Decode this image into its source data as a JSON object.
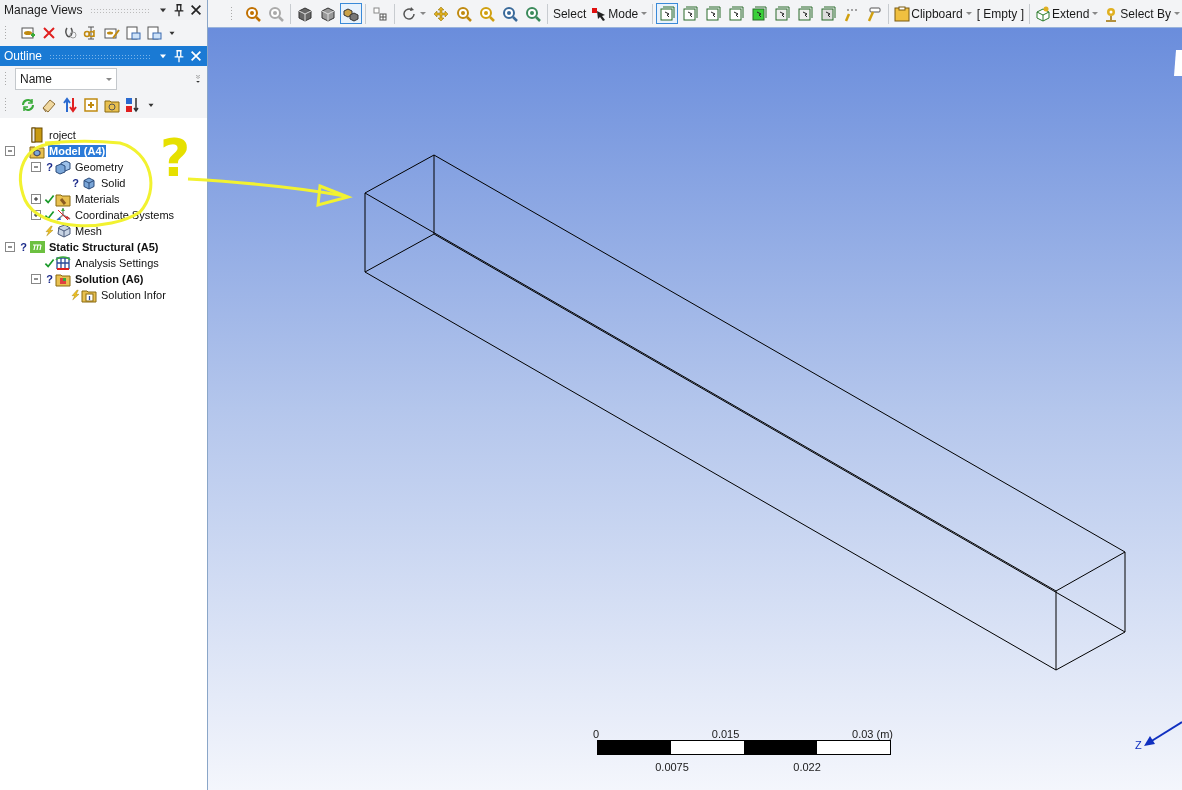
{
  "manage_views": {
    "title": "Manage Views"
  },
  "outline": {
    "title": "Outline",
    "sort_field": "Name"
  },
  "tree": [
    {
      "label": "roject",
      "bold": false,
      "selected": false,
      "children": [
        {
          "label": "Model (A4)",
          "bold": true,
          "selected": true,
          "expanded": true,
          "children": [
            {
              "label": "Geometry",
              "bold": false,
              "selected": false,
              "expanded": true,
              "kind": "question",
              "mark": "?",
              "children": [
                {
                  "label": "Solid",
                  "bold": false,
                  "selected": false,
                  "kind": "question",
                  "mark": "?"
                }
              ]
            },
            {
              "label": "Materials",
              "bold": false,
              "selected": false,
              "expanded": false,
              "kind": "ok"
            },
            {
              "label": "Coordinate Systems",
              "bold": false,
              "selected": false,
              "expanded": false,
              "kind": "ok"
            },
            {
              "label": "Mesh",
              "bold": false,
              "selected": false,
              "kind": "pending"
            }
          ]
        },
        {
          "label": "Static Structural (A5)",
          "bold": true,
          "selected": false,
          "expanded": true,
          "kind": "question",
          "mark": "?",
          "children": [
            {
              "label": "Analysis Settings",
              "bold": false,
              "selected": false,
              "kind": "ok"
            },
            {
              "label": "Solution (A6)",
              "bold": true,
              "selected": false,
              "expanded": true,
              "kind": "question",
              "mark": "?",
              "children": [
                {
                  "label": "Solution Infor",
                  "bold": false,
                  "selected": false,
                  "kind": "pending"
                }
              ]
            }
          ]
        }
      ]
    }
  ],
  "toolbar": [
    {
      "kind": "icon",
      "selected": false
    },
    {
      "kind": "icon",
      "selected": false
    },
    {
      "kind": "separator"
    },
    {
      "kind": "icon",
      "selected": false
    },
    {
      "kind": "icon",
      "selected": false
    },
    {
      "kind": "icon",
      "selected": true
    },
    {
      "kind": "separator"
    },
    {
      "kind": "icon",
      "selected": false
    },
    {
      "kind": "separator"
    },
    {
      "kind": "icon",
      "selected": false,
      "dropdown": true
    },
    {
      "kind": "icon",
      "selected": false
    },
    {
      "kind": "icon",
      "selected": false
    },
    {
      "kind": "icon",
      "selected": false
    },
    {
      "kind": "icon",
      "selected": false
    },
    {
      "kind": "icon",
      "selected": false
    },
    {
      "kind": "separator"
    },
    {
      "kind": "text",
      "label": "Select"
    },
    {
      "kind": "menu",
      "label": "Mode"
    },
    {
      "kind": "separator"
    },
    {
      "kind": "icon",
      "selected": true
    },
    {
      "kind": "icon",
      "selected": false
    },
    {
      "kind": "icon",
      "selected": false
    },
    {
      "kind": "icon",
      "selected": false
    },
    {
      "kind": "icon",
      "selected": false
    },
    {
      "kind": "icon",
      "selected": false
    },
    {
      "kind": "icon",
      "selected": false
    },
    {
      "kind": "icon",
      "selected": false
    },
    {
      "kind": "icon",
      "selected": false
    },
    {
      "kind": "icon",
      "selected": false
    },
    {
      "kind": "separator"
    },
    {
      "kind": "menu",
      "label": "Clipboard"
    },
    {
      "kind": "text",
      "label": "[ Empty ]"
    },
    {
      "kind": "separator"
    },
    {
      "kind": "menu",
      "label": "Extend"
    },
    {
      "kind": "menu",
      "label": "Select By"
    }
  ],
  "annotation": {
    "mark": "?"
  },
  "scale_bar": {
    "top_labels": [
      "0",
      "0.015",
      "0.03 (m)"
    ],
    "bottom_labels": [
      "0.0075",
      "0.022"
    ]
  },
  "triad": {
    "axis_label": "Z"
  }
}
